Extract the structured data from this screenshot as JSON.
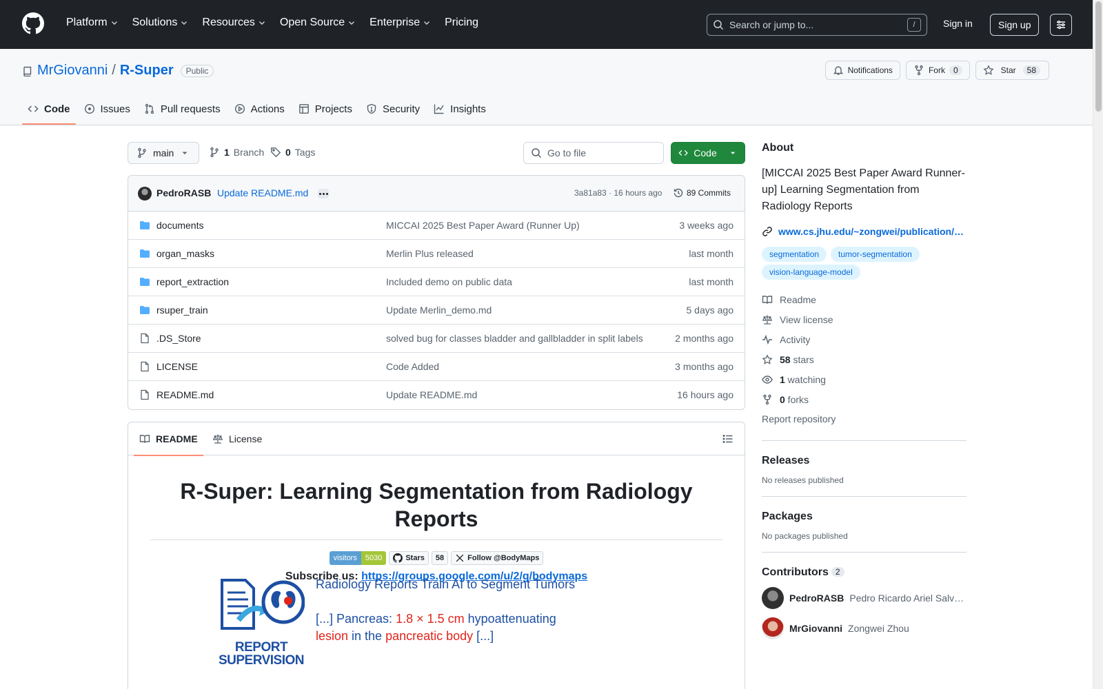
{
  "header": {
    "nav": [
      "Platform",
      "Solutions",
      "Resources",
      "Open Source",
      "Enterprise",
      "Pricing"
    ],
    "search_placeholder": "Search or jump to...",
    "search_shortcut": "/",
    "signin": "Sign in",
    "signup": "Sign up"
  },
  "repo": {
    "owner": "MrGiovanni",
    "separator": "/",
    "name": "R-Super",
    "visibility": "Public",
    "notifications_label": "Notifications",
    "fork_label": "Fork",
    "fork_count": "0",
    "star_label": "Star",
    "star_count": "58",
    "tabs": [
      "Code",
      "Issues",
      "Pull requests",
      "Actions",
      "Projects",
      "Security",
      "Insights"
    ]
  },
  "filebar": {
    "branch": "main",
    "branches_count": "1",
    "branches_label": "Branch",
    "tags_count": "0",
    "tags_label": "Tags",
    "goto_placeholder": "Go to file",
    "code_label": "Code"
  },
  "commit": {
    "author": "PedroRASB",
    "message": "Update README.md",
    "meta": "3a81a83 · 16 hours ago",
    "count": "89 Commits"
  },
  "files": [
    {
      "type": "dir",
      "name": "documents",
      "message": "MICCAI 2025 Best Paper Award (Runner Up)",
      "age": "3 weeks ago"
    },
    {
      "type": "dir",
      "name": "organ_masks",
      "message": "Merlin Plus released",
      "age": "last month"
    },
    {
      "type": "dir",
      "name": "report_extraction",
      "message": "Included demo on public data",
      "age": "last month"
    },
    {
      "type": "dir",
      "name": "rsuper_train",
      "message": "Update Merlin_demo.md",
      "age": "5 days ago"
    },
    {
      "type": "file",
      "name": ".DS_Store",
      "message": "solved bug for classes bladder and gallbladder in split labels",
      "age": "2 months ago"
    },
    {
      "type": "file",
      "name": "LICENSE",
      "message": "Code Added",
      "age": "3 months ago"
    },
    {
      "type": "file",
      "name": "README.md",
      "message": "Update README.md",
      "age": "16 hours ago"
    }
  ],
  "readme": {
    "tab_readme": "README",
    "tab_license": "License",
    "title": "R-Super: Learning Segmentation from Radiology Reports",
    "shield_visitors_label": "visitors",
    "shield_visitors_value": "5030",
    "shield_stars_label": "Stars",
    "shield_stars_value": "58",
    "shield_follow": "Follow @BodyMaps",
    "subscribe_label": "Subscribe us:",
    "subscribe_link": "https://groups.google.com/u/2/g/bodymaps",
    "figure": {
      "logo_text_1": "REPORT",
      "logo_text_2": "SUPERVISION",
      "caption": "Radiology Reports Train AI to Segment Tumors",
      "line1_a": "[...] Pancreas: ",
      "line1_b": "1.8 × 1.5 cm",
      "line1_c": " hypoattenuating",
      "line2_a": "lesion",
      "line2_b": " in the ",
      "line2_c": "pancreatic body",
      "line2_d": " [...]"
    }
  },
  "sidebar": {
    "about_title": "About",
    "description": "[MICCAI 2025 Best Paper Award Runner-up] Learning Segmentation from Radiology Reports",
    "link": "www.cs.jhu.edu/~zongwei/publication/…",
    "topics": [
      "segmentation",
      "tumor-segmentation",
      "vision-language-model"
    ],
    "readme": "Readme",
    "license": "View license",
    "activity": "Activity",
    "stars_count": "58",
    "stars_label": " stars",
    "watching_count": "1",
    "watching_label": " watching",
    "forks_count": "0",
    "forks_label": " forks",
    "report": "Report repository",
    "releases_title": "Releases",
    "releases_text": "No releases published",
    "packages_title": "Packages",
    "packages_text": "No packages published",
    "contributors_title": "Contributors",
    "contributors_count": "2",
    "contributors": [
      {
        "login": "PedroRASB",
        "name": "Pedro Ricardo Ariel Salv…"
      },
      {
        "login": "MrGiovanni",
        "name": "Zongwei Zhou"
      }
    ]
  },
  "colors": {
    "header_bg": "#1f2328",
    "accent_link": "#0969da",
    "code_button": "#1f883d",
    "active_tab_underline": "#fd8c73",
    "readme_blue": "#1d4fa3",
    "readme_red": "#e0251b"
  }
}
